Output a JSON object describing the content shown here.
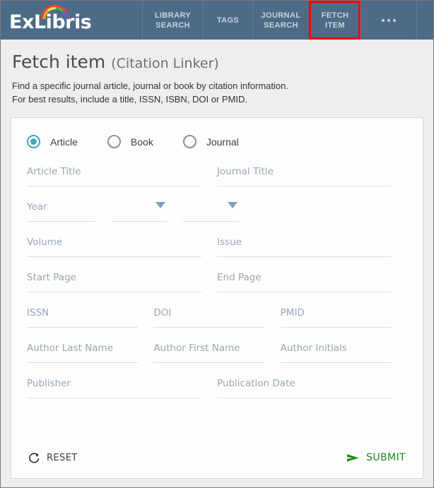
{
  "header": {
    "logo_text": "ExLibris",
    "logo_arc_icon": "rainbow-arc-icon",
    "nav": [
      {
        "label": "LIBRARY\nSEARCH",
        "name": "library-search",
        "width": "nav-w-lib",
        "highlight": false
      },
      {
        "label": "TAGS",
        "name": "tags",
        "width": "nav-w-tags",
        "highlight": false
      },
      {
        "label": "JOURNAL\nSEARCH",
        "name": "journal-search",
        "width": "nav-w-jrnl",
        "highlight": false
      },
      {
        "label": "FETCH ITEM",
        "name": "fetch-item",
        "width": "nav-w-fetch",
        "highlight": true
      },
      {
        "label": "",
        "name": "more-menu",
        "width": "nav-w-more",
        "highlight": false
      }
    ],
    "background_color": "#4d6b87",
    "highlight_color": "#ff0000"
  },
  "title": {
    "main": "Fetch item",
    "sub": "(Citation Linker)",
    "description_line1": "Find a specific journal article, journal or book by citation information.",
    "description_line2": "For best results, include a title, ISSN, ISBN, DOI or PMID."
  },
  "resource_type": {
    "selected": "Article",
    "accent_color": "#3fa9b5",
    "options": [
      {
        "label": "Article",
        "checked": true
      },
      {
        "label": "Book",
        "checked": false
      },
      {
        "label": "Journal",
        "checked": false
      }
    ]
  },
  "form": {
    "article_title": {
      "placeholder": "Article Title",
      "value": ""
    },
    "journal_title": {
      "placeholder": "Journal Title",
      "value": ""
    },
    "year": {
      "placeholder": "Year",
      "value": ""
    },
    "month_select": {
      "placeholder": "",
      "value": ""
    },
    "day_select": {
      "placeholder": "",
      "value": ""
    },
    "volume": {
      "placeholder": "Volume",
      "value": ""
    },
    "issue": {
      "placeholder": "Issue",
      "value": ""
    },
    "start_page": {
      "placeholder": "Start Page",
      "value": ""
    },
    "end_page": {
      "placeholder": "End Page",
      "value": ""
    },
    "issn": {
      "placeholder": "ISSN",
      "value": ""
    },
    "doi": {
      "placeholder": "DOI",
      "value": ""
    },
    "pmid": {
      "placeholder": "PMID",
      "value": ""
    },
    "author_last_name": {
      "placeholder": "Author Last Name",
      "value": ""
    },
    "author_first_name": {
      "placeholder": "Author First Name",
      "value": ""
    },
    "author_initials": {
      "placeholder": "Author Initials",
      "value": ""
    },
    "publisher": {
      "placeholder": "Publisher",
      "value": ""
    },
    "publication_date": {
      "placeholder": "Publication Date",
      "value": ""
    }
  },
  "actions": {
    "reset_label": "RESET",
    "reset_icon": "refresh-circular-arrow-icon",
    "submit_label": "SUBMIT",
    "submit_icon": "send-arrow-icon",
    "submit_color": "#178a18"
  }
}
